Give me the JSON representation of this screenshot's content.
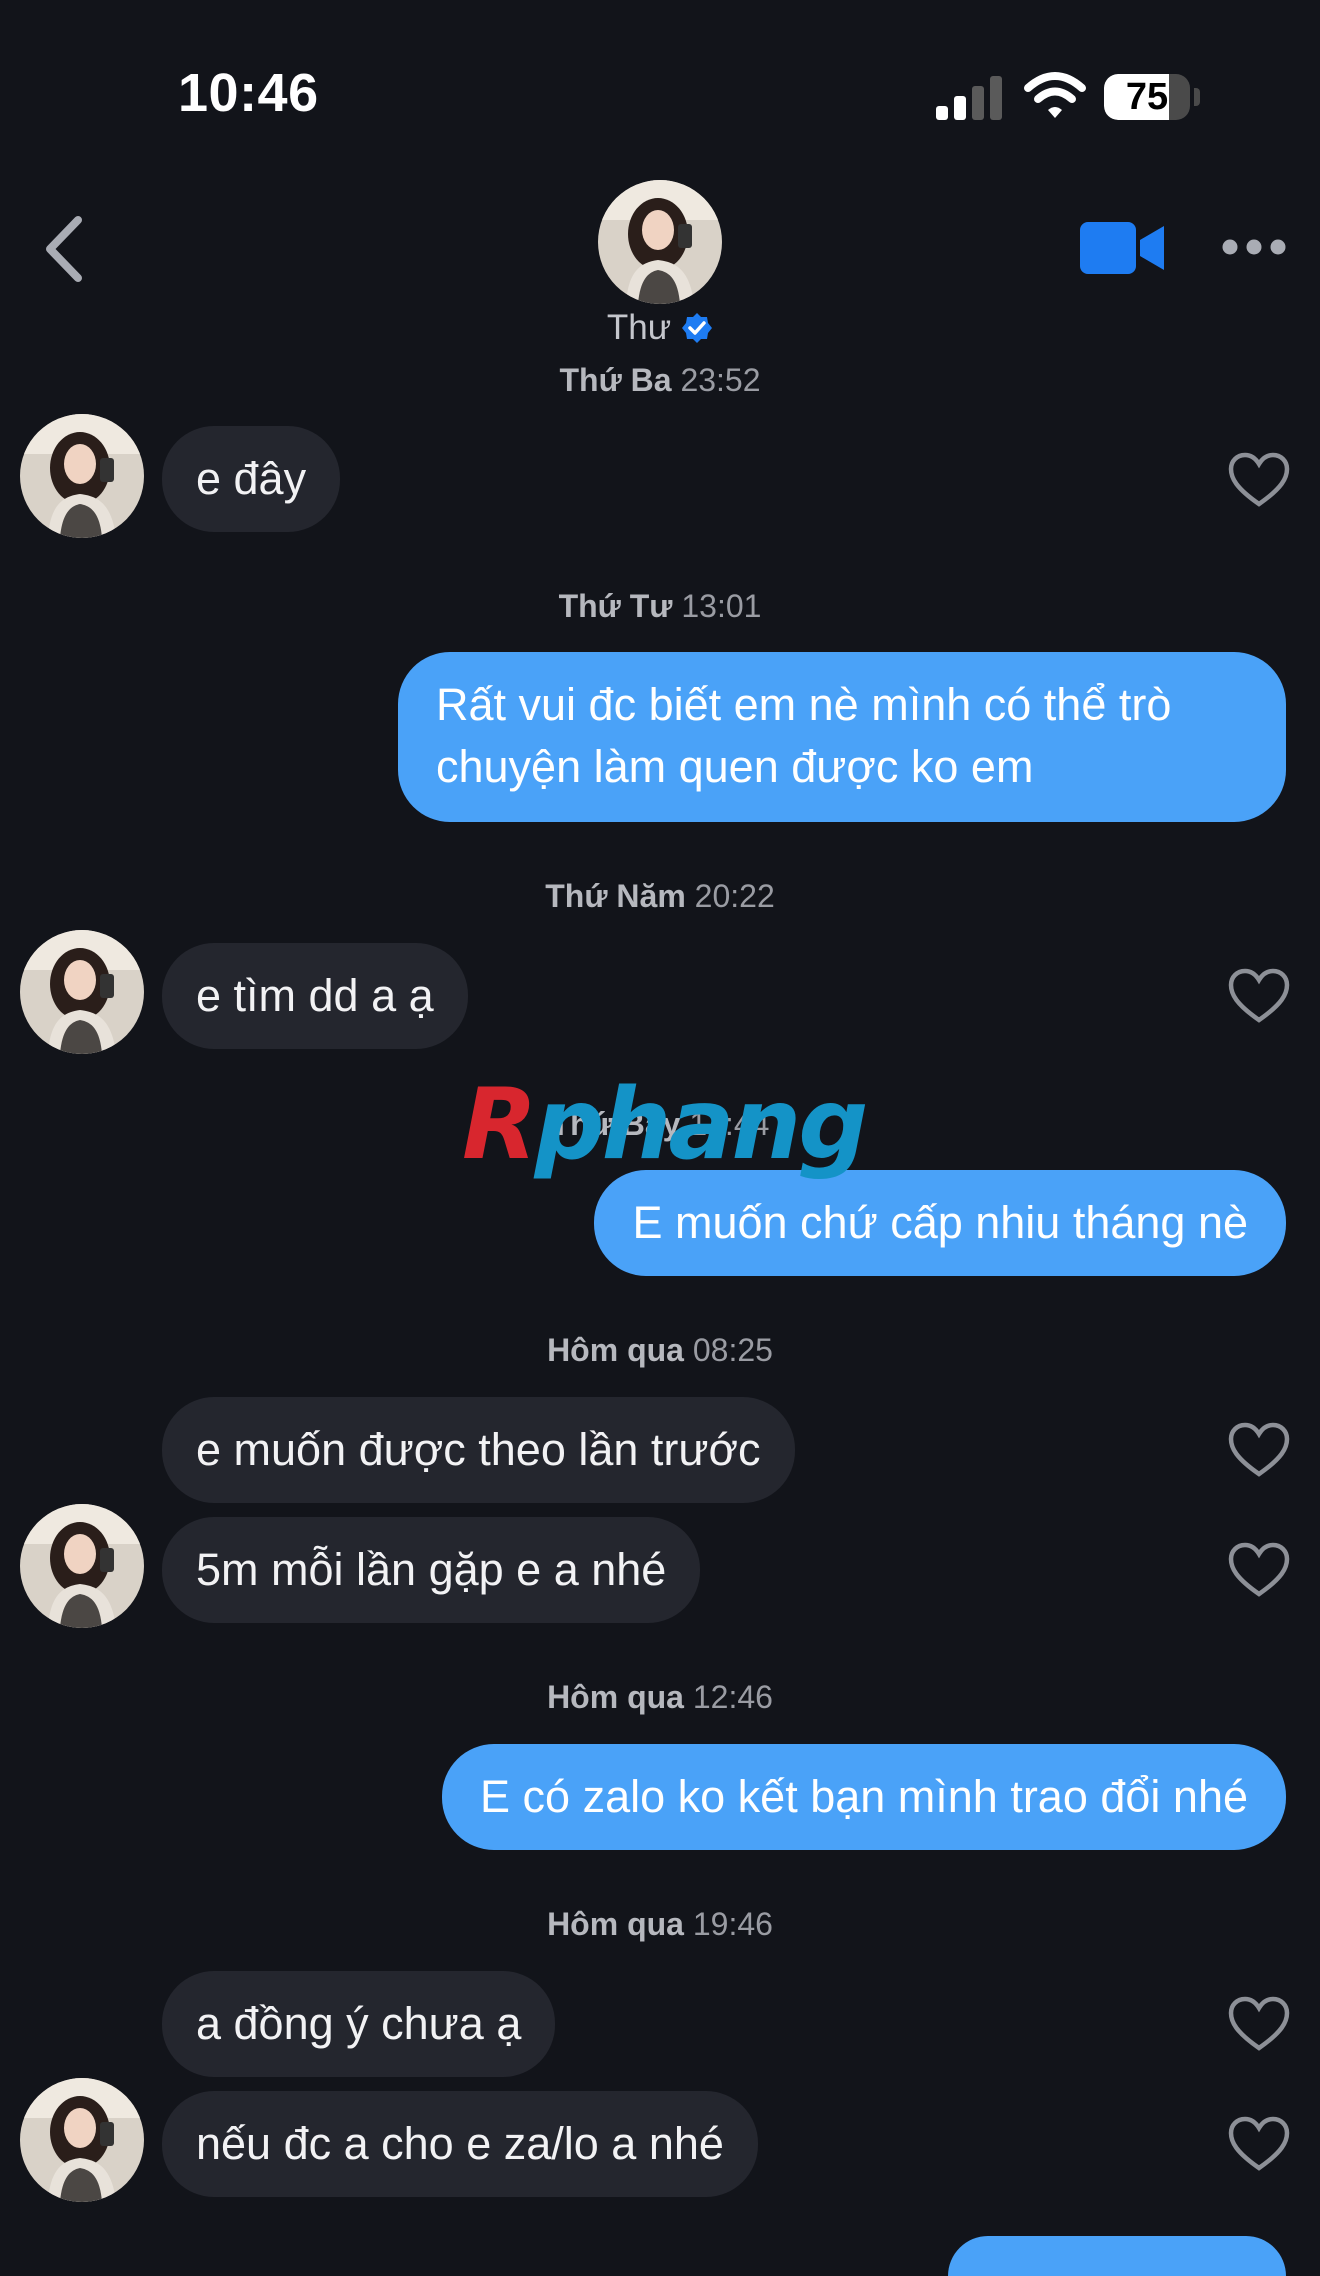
{
  "status_bar": {
    "time": "10:46",
    "battery_level": "75",
    "battery_fraction": 0.75
  },
  "header": {
    "contact_name": "Thư",
    "verified": true,
    "icons": [
      "back-arrow-icon",
      "video-call-icon",
      "more-icon"
    ]
  },
  "colors": {
    "background": "#12141a",
    "incoming_bubble": "#24262e",
    "outgoing_bubble": "#4aa2f8",
    "accent": "#1e7cf2"
  },
  "conversation": {
    "ts0_day": "Thứ Ba",
    "ts0_time": "23:52",
    "m0": "e đây",
    "ts1_day": "Thứ Tư",
    "ts1_time": "13:01",
    "m1": "Rất vui đc biết em nè mình có thể trò chuyện làm quen được ko em",
    "ts2_day": "Thứ Năm",
    "ts2_time": "20:22",
    "m2": "e tìm dd a ạ",
    "ts3_day": "Thứ Bảy",
    "ts3_time": "17:44",
    "m3": "E muốn chứ cấp nhiu tháng nè",
    "ts4_day": "Hôm qua",
    "ts4_time": "08:25",
    "m4": "e muốn được theo lần trước",
    "m5": "5m mỗi lần gặp e a nhé",
    "ts5_day": "Hôm qua",
    "ts5_time": "12:46",
    "m6": "E có zalo ko  kết bạn mình trao đổi nhé",
    "ts6_day": "Hôm qua",
    "ts6_time": "19:46",
    "m7": "a đồng ý chưa ạ",
    "m8": "nếu đc a cho e za/lo a nhé"
  },
  "watermark": {
    "part1": "R",
    "part2": "phang"
  }
}
